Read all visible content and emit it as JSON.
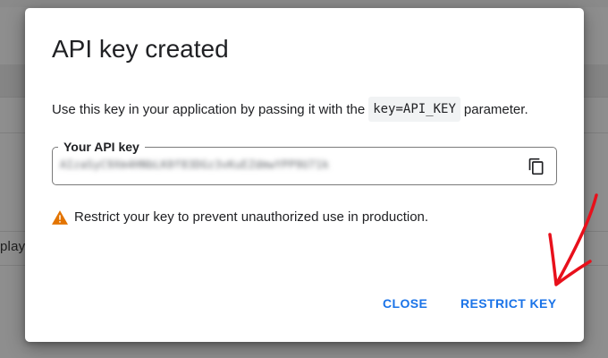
{
  "background": {
    "side_text": "play"
  },
  "dialog": {
    "title": "API key created",
    "description": {
      "before": "Use this key in your application by passing it with the",
      "code": "key=API_KEY",
      "after": "parameter."
    },
    "key_field": {
      "label": "Your API key",
      "value": "AIzaSyC9Xm4HNbLK0f83DGz3vKuEZdmwYPP9U71k"
    },
    "warning": "Restrict your key to prevent unauthorized use in production.",
    "buttons": {
      "close": "CLOSE",
      "restrict": "RESTRICT KEY"
    }
  },
  "colors": {
    "accent": "#1a73e8",
    "warning": "#e37400",
    "annotation": "#e8101b",
    "overlay": "#8e8e8e"
  },
  "icons": {
    "copy": "copy-icon",
    "warning": "warning-icon",
    "annotation": "red-arrow-annotation"
  }
}
